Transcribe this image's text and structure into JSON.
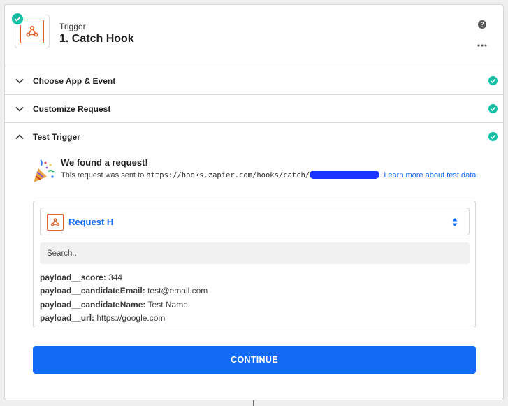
{
  "step": {
    "type": "Trigger",
    "title": "1. Catch Hook",
    "app_icon": "webhook-icon",
    "status_icon": "check-circle-icon",
    "help_icon": "question-circle-icon",
    "more_icon": "ellipsis-icon"
  },
  "sections": [
    {
      "label": "Choose App & Event",
      "expanded": false,
      "status": "complete"
    },
    {
      "label": "Customize Request",
      "expanded": false,
      "status": "complete"
    },
    {
      "label": "Test Trigger",
      "expanded": true,
      "status": "complete"
    }
  ],
  "test": {
    "found_title": "We found a request!",
    "desc_prefix": "This request was sent to ",
    "url_prefix": "https://hooks.zapier.com/hooks/catch/",
    "desc_suffix": ". ",
    "learn_more": "Learn more about test data.",
    "icon": "party-popper-icon"
  },
  "request": {
    "selected": "Request H",
    "search_placeholder": "Search...",
    "fields": [
      {
        "key": "payload__score:",
        "value": "344"
      },
      {
        "key": "payload__candidateEmail:",
        "value": "test@email.com"
      },
      {
        "key": "payload__candidateName:",
        "value": "Test Name"
      },
      {
        "key": "payload__url:",
        "value": "https://google.com"
      }
    ]
  },
  "continue_label": "CONTINUE",
  "colors": {
    "accent": "#136bf5",
    "success": "#13c0a6",
    "brand": "#e2622b"
  }
}
